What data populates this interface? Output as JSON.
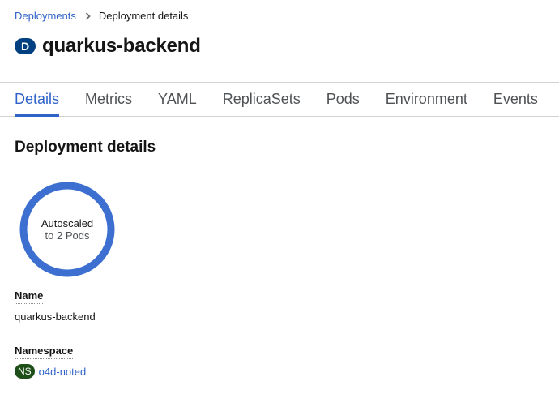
{
  "breadcrumb": {
    "parent": "Deployments",
    "current": "Deployment details"
  },
  "header": {
    "kind_badge": "D",
    "title": "quarkus-backend"
  },
  "tabs": [
    {
      "label": "Details",
      "active": true
    },
    {
      "label": "Metrics",
      "active": false
    },
    {
      "label": "YAML",
      "active": false
    },
    {
      "label": "ReplicaSets",
      "active": false
    },
    {
      "label": "Pods",
      "active": false
    },
    {
      "label": "Environment",
      "active": false
    },
    {
      "label": "Events",
      "active": false
    }
  ],
  "details": {
    "section_title": "Deployment details",
    "pod_ring": {
      "line1": "Autoscaled",
      "line2": "to 2 Pods",
      "color": "#3c6fd0"
    },
    "name_label": "Name",
    "name_value": "quarkus-backend",
    "namespace_label": "Namespace",
    "namespace_badge": "NS",
    "namespace_value": "o4d-noted"
  },
  "colors": {
    "link": "#2f63c8",
    "kind_badge_bg": "#004080",
    "ns_badge_bg": "#1e4f18"
  }
}
